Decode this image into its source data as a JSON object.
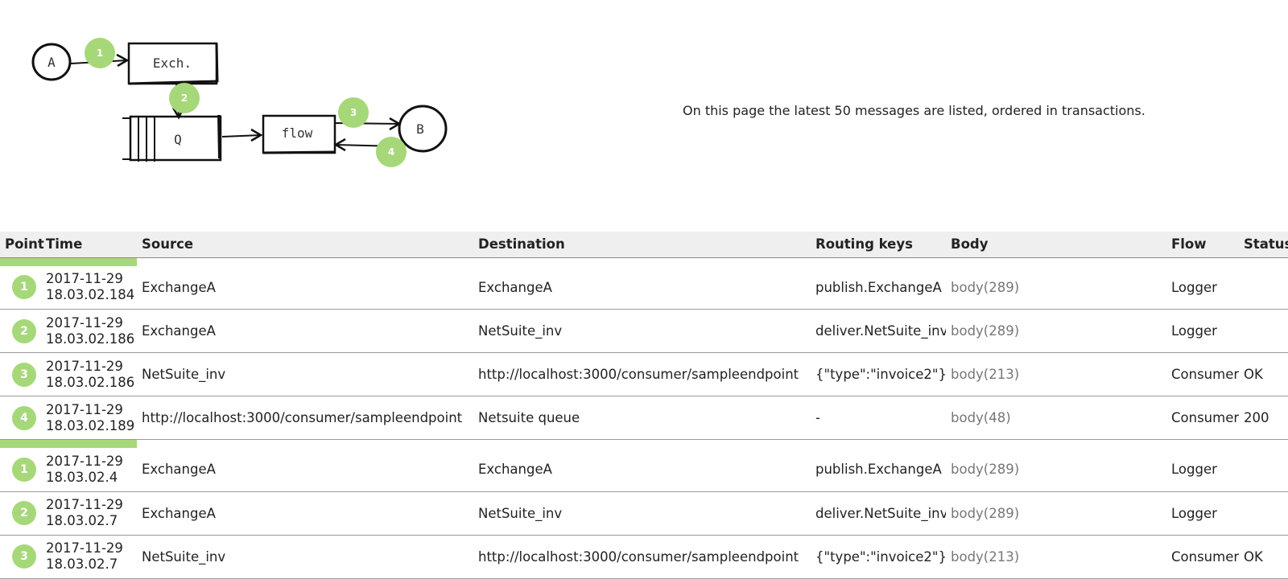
{
  "diagram": {
    "node_a": "A",
    "exchange": "Exch.",
    "queue": "Q",
    "flow": "flow",
    "node_b": "B",
    "markers": [
      "1",
      "2",
      "3",
      "4"
    ],
    "accent_color": "#a6d879"
  },
  "intro": "On this page the latest 50 messages are listed, ordered in transactions.",
  "table": {
    "headers": {
      "point": "Point",
      "time": "Time",
      "source": "Source",
      "destination": "Destination",
      "routing_keys": "Routing keys",
      "body": "Body",
      "flow": "Flow",
      "status": "Status"
    },
    "transactions": [
      {
        "rows": [
          {
            "point": "1",
            "date": "2017-11-29",
            "time": "18.03.02.184",
            "source": "ExchangeA",
            "destination": "ExchangeA",
            "routing_keys": "publish.ExchangeA",
            "body": "body(289)",
            "flow": "Logger",
            "status": ""
          },
          {
            "point": "2",
            "date": "2017-11-29",
            "time": "18.03.02.186",
            "source": "ExchangeA",
            "destination": "NetSuite_inv",
            "routing_keys": "deliver.NetSuite_inv",
            "body": "body(289)",
            "flow": "Logger",
            "status": ""
          },
          {
            "point": "3",
            "date": "2017-11-29",
            "time": "18.03.02.186",
            "source": "NetSuite_inv",
            "destination": "http://localhost:3000/consumer/sampleendpoint",
            "routing_keys": "{\"type\":\"invoice2\"}",
            "body": "body(213)",
            "flow": "Consumer",
            "status": "OK"
          },
          {
            "point": "4",
            "date": "2017-11-29",
            "time": "18.03.02.189",
            "source": "http://localhost:3000/consumer/sampleendpoint",
            "destination": "Netsuite queue",
            "routing_keys": "-",
            "body": "body(48)",
            "flow": "Consumer",
            "status": "200"
          }
        ]
      },
      {
        "rows": [
          {
            "point": "1",
            "date": "2017-11-29",
            "time": "18.03.02.4",
            "source": "ExchangeA",
            "destination": "ExchangeA",
            "routing_keys": "publish.ExchangeA",
            "body": "body(289)",
            "flow": "Logger",
            "status": ""
          },
          {
            "point": "2",
            "date": "2017-11-29",
            "time": "18.03.02.7",
            "source": "ExchangeA",
            "destination": "NetSuite_inv",
            "routing_keys": "deliver.NetSuite_inv",
            "body": "body(289)",
            "flow": "Logger",
            "status": ""
          },
          {
            "point": "3",
            "date": "2017-11-29",
            "time": "18.03.02.7",
            "source": "NetSuite_inv",
            "destination": "http://localhost:3000/consumer/sampleendpoint",
            "routing_keys": "{\"type\":\"invoice2\"}",
            "body": "body(213)",
            "flow": "Consumer",
            "status": "OK"
          }
        ]
      }
    ]
  }
}
